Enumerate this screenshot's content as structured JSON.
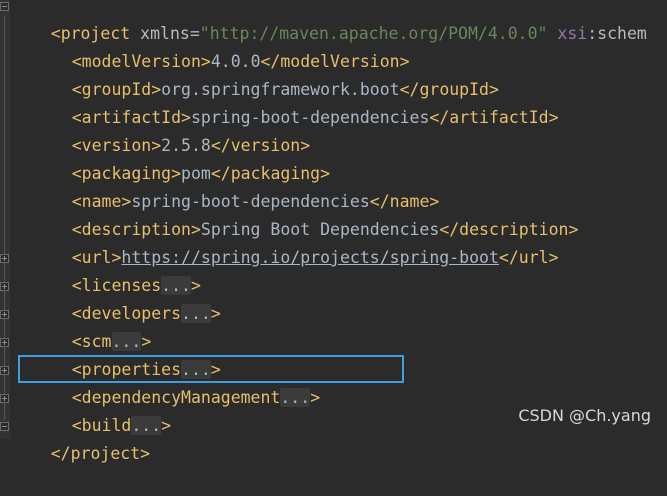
{
  "editor": {
    "lines": [
      {
        "open": "<",
        "tag": "project",
        "sp": " ",
        "attr1": "xmlns",
        "eq": "=",
        "val1": "\"http://maven.apache.org/POM/4.0.0\"",
        "sp2": " ",
        "ns": "xsi",
        ":": ":",
        "attr2": "schem"
      },
      {
        "open": "<modelVersion>",
        "text": "4.0.0",
        "close": "</modelVersion>"
      },
      {
        "open": "<groupId>",
        "text": "org.springframework.boot",
        "close": "</groupId>"
      },
      {
        "open": "<artifactId>",
        "text": "spring-boot-dependencies",
        "close": "</artifactId>"
      },
      {
        "open": "<version>",
        "text": "2.5.8",
        "close": "</version>"
      },
      {
        "open": "<packaging>",
        "text": "pom",
        "close": "</packaging>"
      },
      {
        "open": "<name>",
        "text": "spring-boot-dependencies",
        "close": "</name>"
      },
      {
        "open": "<description>",
        "text": "Spring Boot Dependencies",
        "close": "</description>"
      },
      {
        "open": "<url>",
        "text": "https://spring.io/projects/spring-boot",
        "close": "</url>"
      },
      {
        "open": "<licenses",
        "ell": "...",
        "close": ">"
      },
      {
        "open": "<developers",
        "ell": "...",
        "close": ">"
      },
      {
        "open": "<scm",
        "ell": "...",
        "close": ">"
      },
      {
        "open": "<properties",
        "ell": "...",
        "close": ">"
      },
      {
        "open": "<dependencyManagement",
        "ell": "...",
        "close": ">"
      },
      {
        "open": "<build",
        "ell": "...",
        "close": ">"
      },
      {
        "open": "</project>"
      }
    ]
  },
  "watermark": "CSDN @Ch.yang"
}
